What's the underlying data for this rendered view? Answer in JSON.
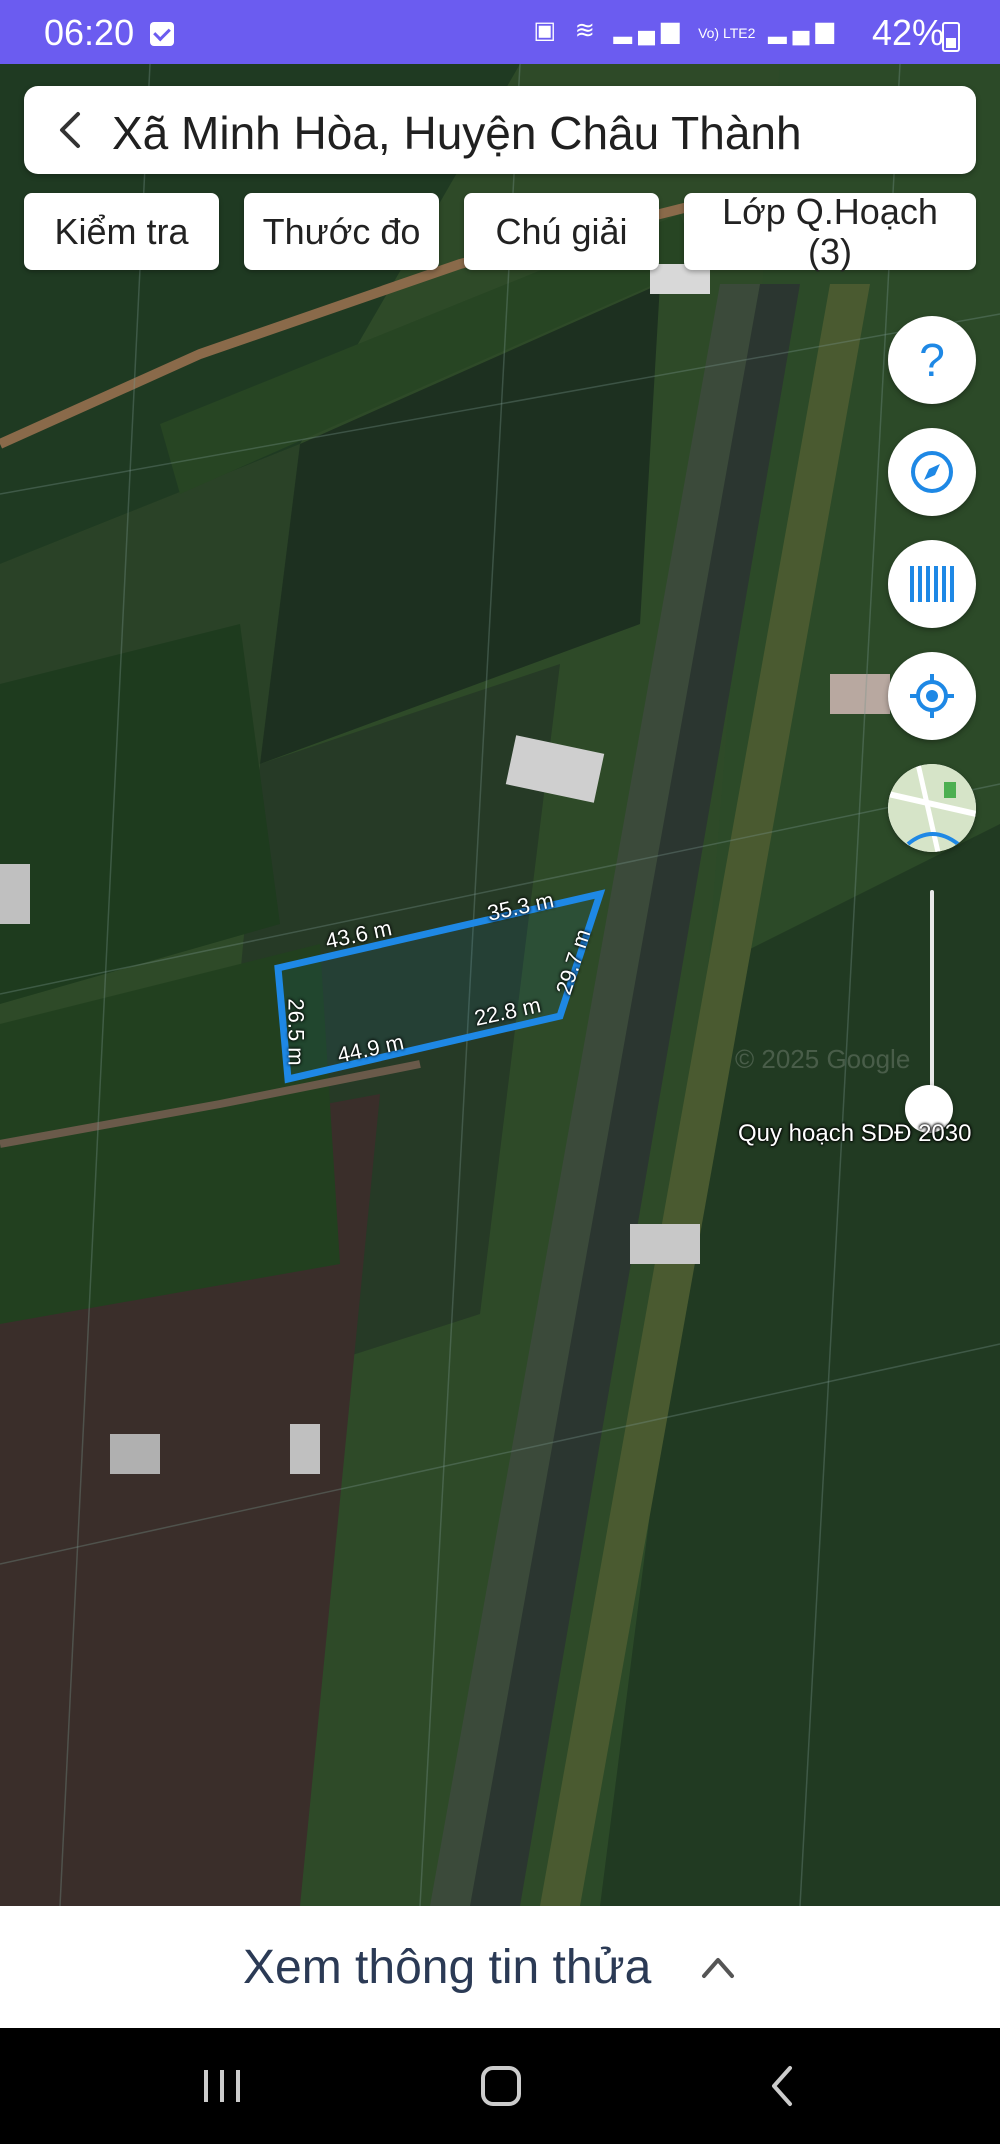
{
  "status_bar": {
    "time": "06:20",
    "signal_text": "Vo) LTE2",
    "battery": "42%"
  },
  "header": {
    "title": "Xã Minh Hòa, Huyện Châu Thành"
  },
  "toolbar": {
    "check": "Kiểm tra",
    "measure": "Thước đo",
    "legend": "Chú giải",
    "layers_line1": "Lớp Q.Hoạch",
    "layers_line2": "(3)"
  },
  "map": {
    "measurements": {
      "top_left": "43.6 m",
      "top_right": "35.3 m",
      "right": "29.7 m",
      "left": "26.5 m",
      "bottom_left": "44.9 m",
      "bottom_right": "22.8 m"
    },
    "plot_color": "#1e88e5",
    "watermark": "© 2025 Google",
    "slider_label": "Quy hoạch SDĐ 2030"
  },
  "fabs": {
    "help_icon": "question-mark-icon",
    "compass_icon": "compass-icon",
    "barcode_icon": "barcode-icon",
    "locate_icon": "my-location-icon",
    "map_type_icon": "map-thumbnail-icon"
  },
  "bottom_sheet": {
    "label": "Xem thông tin thửa"
  }
}
